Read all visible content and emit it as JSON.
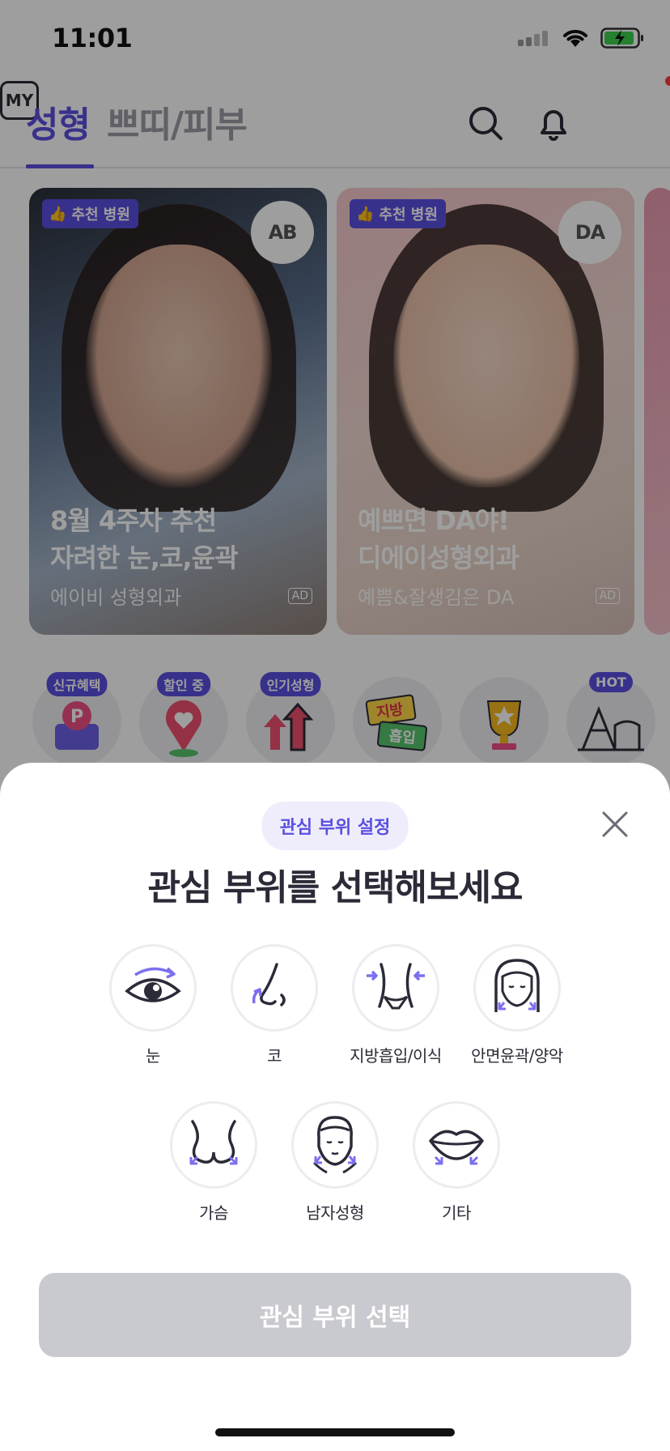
{
  "status_bar": {
    "time": "11:01"
  },
  "nav": {
    "tab_active": "성형",
    "tab_inactive": "쁘띠/피부",
    "my_label": "MY"
  },
  "banners": [
    {
      "badge": "추천 병원",
      "logo": "AB",
      "title_line1": "8월 4주차 추천",
      "title_line2": "자려한 눈,코,윤곽",
      "subtitle": "에이비 성형외과",
      "ad": "AD"
    },
    {
      "badge": "추천 병원",
      "logo": "DA",
      "title_line1": "예쁘면 DA야!",
      "title_line2": "디에이성형외과",
      "subtitle": "예쁨&잘생김은 DA",
      "ad": "AD"
    }
  ],
  "categories": [
    {
      "badge": "신규혜택",
      "icon": "p-point-icon"
    },
    {
      "badge": "할인 중",
      "icon": "heart-pin-icon"
    },
    {
      "badge": "인기성형",
      "icon": "trending-arrows-icon"
    },
    {
      "badge": "",
      "icon": "fat-suction-sign-icon",
      "sign_line1": "지방",
      "sign_line2": "흡입"
    },
    {
      "badge": "",
      "icon": "trophy-icon"
    },
    {
      "badge": "HOT",
      "icon": "city-landmark-icon"
    }
  ],
  "sheet": {
    "chip": "관심 부위 설정",
    "title": "관심 부위를 선택해보세요",
    "parts": [
      {
        "label": "눈",
        "icon": "eye-icon"
      },
      {
        "label": "코",
        "icon": "nose-icon"
      },
      {
        "label": "지방흡입/이식",
        "icon": "waist-icon"
      },
      {
        "label": "안면윤곽/양악",
        "icon": "face-contour-icon"
      },
      {
        "label": "가슴",
        "icon": "chest-icon"
      },
      {
        "label": "남자성형",
        "icon": "male-face-icon"
      },
      {
        "label": "기타",
        "icon": "lips-icon"
      }
    ],
    "button": "관심 부위 선택"
  },
  "colors": {
    "accent": "#5b4fe0",
    "button_disabled": "#c9c9d0",
    "chip_bg": "#efedfc"
  }
}
